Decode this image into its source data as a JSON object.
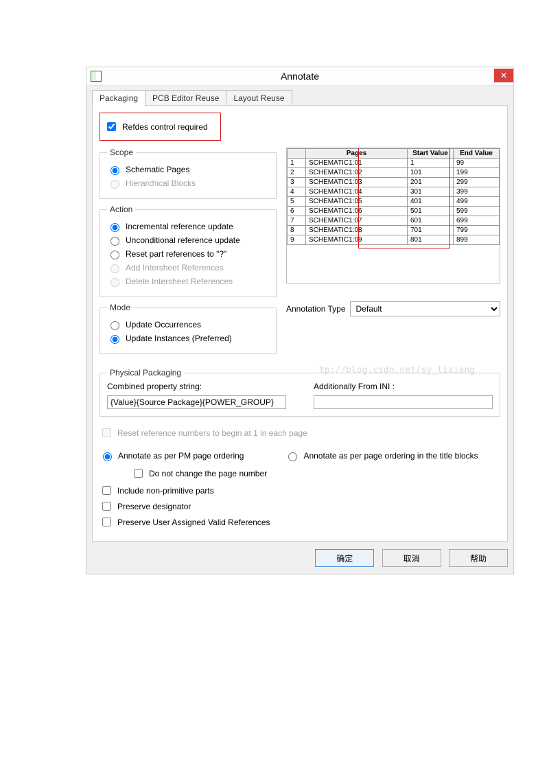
{
  "window": {
    "title": "Annotate"
  },
  "tabs": [
    "Packaging",
    "PCB Editor Reuse",
    "Layout Reuse"
  ],
  "refdes_label": "Refdes control required",
  "scope": {
    "legend": "Scope",
    "schematic": "Schematic Pages",
    "hierarchical": "Hierarchical Blocks"
  },
  "action": {
    "legend": "Action",
    "incremental": "Incremental reference update",
    "unconditional": "Unconditional reference update",
    "reset": "Reset part references to \"?\"",
    "add_intersheet": "Add Intersheet References",
    "delete_intersheet": "Delete Intersheet References"
  },
  "mode": {
    "legend": "Mode",
    "occurrences": "Update Occurrences",
    "instances": "Update Instances (Preferred)"
  },
  "grid": {
    "headers": [
      "",
      "Pages",
      "Start Value",
      "End Value"
    ],
    "rows": [
      {
        "n": "1",
        "page": "SCHEMATIC1:01",
        "start": "1",
        "end": "99"
      },
      {
        "n": "2",
        "page": "SCHEMATIC1:02",
        "start": "101",
        "end": "199"
      },
      {
        "n": "3",
        "page": "SCHEMATIC1:03",
        "start": "201",
        "end": "299"
      },
      {
        "n": "4",
        "page": "SCHEMATIC1:04",
        "start": "301",
        "end": "399"
      },
      {
        "n": "5",
        "page": "SCHEMATIC1:05",
        "start": "401",
        "end": "499"
      },
      {
        "n": "6",
        "page": "SCHEMATIC1:06",
        "start": "501",
        "end": "599"
      },
      {
        "n": "7",
        "page": "SCHEMATIC1:07",
        "start": "601",
        "end": "699"
      },
      {
        "n": "8",
        "page": "SCHEMATIC1:08",
        "start": "701",
        "end": "799"
      },
      {
        "n": "9",
        "page": "SCHEMATIC1:09",
        "start": "801",
        "end": "899"
      }
    ]
  },
  "annotation_type": {
    "label": "Annotation Type",
    "value": "Default"
  },
  "physical": {
    "legend": "Physical Packaging",
    "combined_label": "Combined property string:",
    "combined_value": "{Value}{Source Package}{POWER_GROUP}",
    "ini_label": "Additionally From INI :",
    "ini_value": ""
  },
  "reset_each_page": "Reset reference numbers to begin at 1 in each page",
  "order_pm": "Annotate as per PM page ordering",
  "order_title": "Annotate as per page ordering in the title blocks",
  "dont_change_page": "Do not change the page number",
  "include_nonprimitive": "Include non-primitive parts",
  "preserve_designator": "Preserve designator",
  "preserve_user_refs": "Preserve User Assigned Valid References",
  "buttons": {
    "ok": "确定",
    "cancel": "取消",
    "help": "帮助"
  },
  "watermark": "tp://blog.csdn.net/sy_lixiang"
}
